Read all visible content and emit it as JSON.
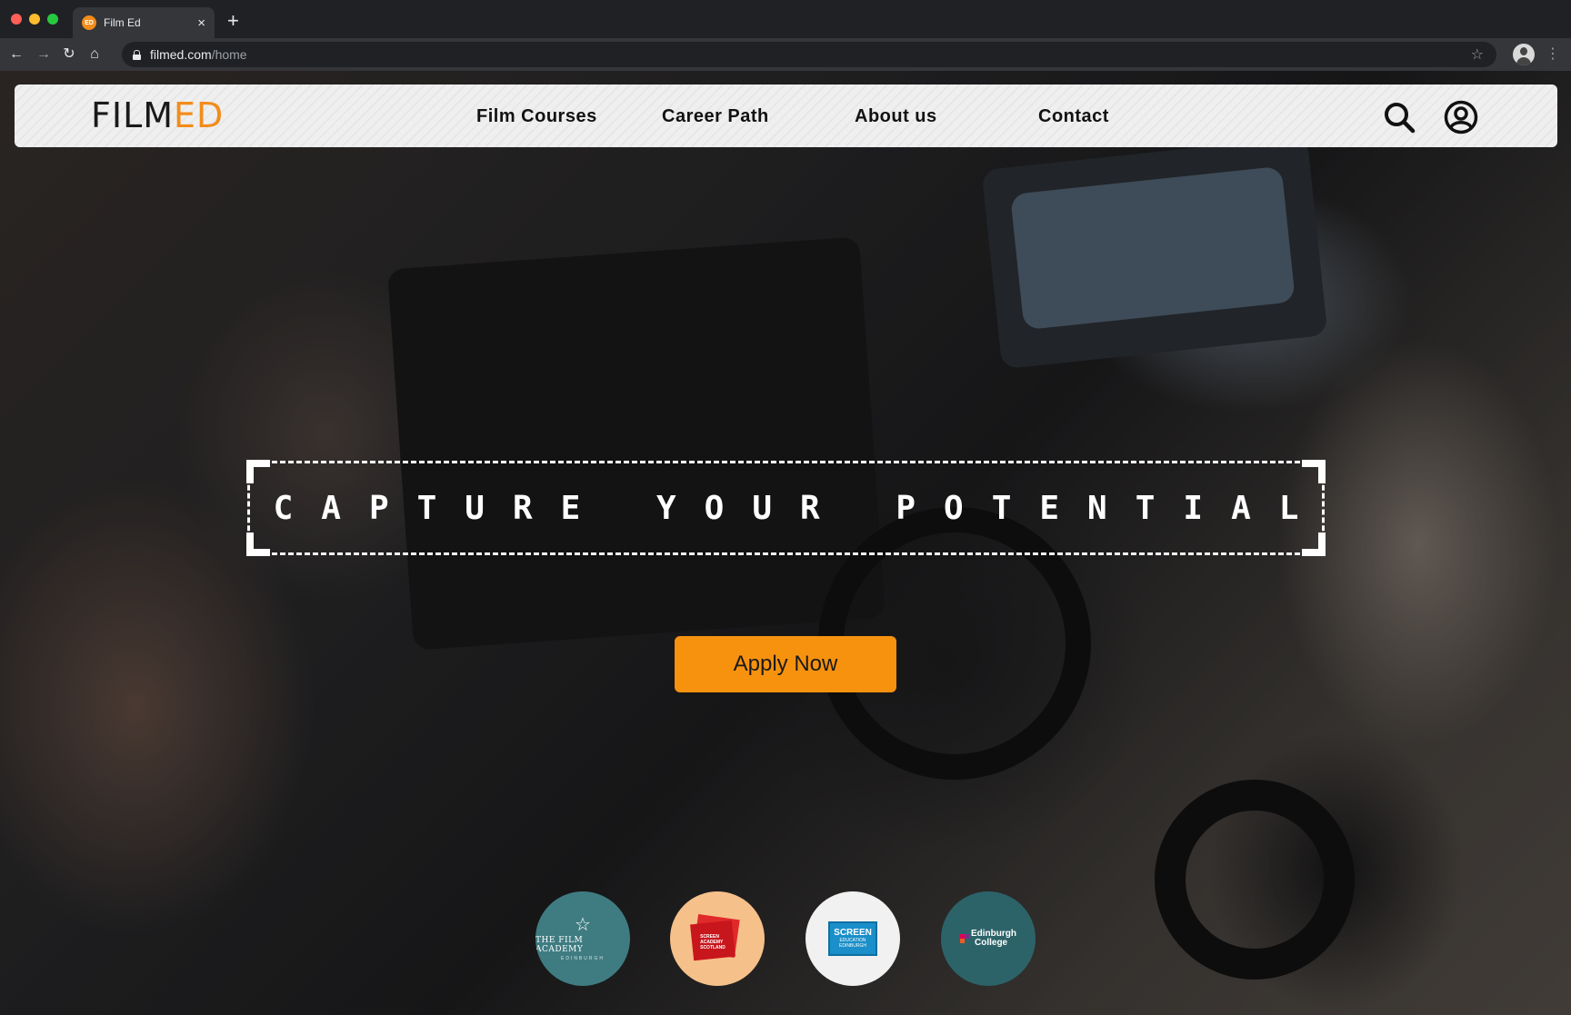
{
  "browser": {
    "tab_title": "Film Ed",
    "tab_favicon_text": "ED",
    "url_host": "filmed.com",
    "url_path": "/home"
  },
  "header": {
    "logo_film": "FILM",
    "logo_ed": "ED",
    "nav": [
      {
        "label": "Film Courses"
      },
      {
        "label": "Career Path"
      },
      {
        "label": "About us"
      },
      {
        "label": "Contact"
      }
    ],
    "icons": [
      "search-icon",
      "account-icon"
    ]
  },
  "hero": {
    "headline": "CAPTURE YOUR POTENTIAL",
    "cta_label": "Apply Now"
  },
  "partners": [
    {
      "name": "The Film Academy",
      "line1": "THE FILM ACADEMY",
      "line2": "EDINBURGH",
      "bg": "#3f7c82"
    },
    {
      "name": "Screen Academy Scotland",
      "line1": "SCREEN",
      "line2": "ACADEMY",
      "line3": "SCOTLAND",
      "bg": "#f6c08a"
    },
    {
      "name": "Screen Education Edinburgh",
      "line1": "SCREEN",
      "line2": "EDUCATION",
      "line3": "EDINBURGH",
      "bg": "#f1f1f1"
    },
    {
      "name": "Edinburgh College",
      "line1": "Edinburgh",
      "line2": "College",
      "bg": "#2c6369"
    }
  ],
  "colors": {
    "accent": "#f7920f",
    "logo_accent": "#f28c1b"
  }
}
